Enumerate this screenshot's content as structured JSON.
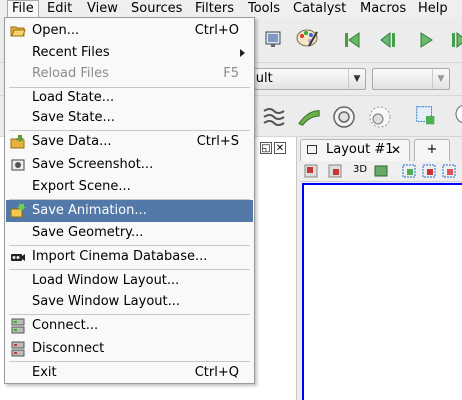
{
  "menubar": {
    "items": [
      {
        "label": "File"
      },
      {
        "label": "Edit"
      },
      {
        "label": "View"
      },
      {
        "label": "Sources"
      },
      {
        "label": "Filters"
      },
      {
        "label": "Tools"
      },
      {
        "label": "Catalyst"
      },
      {
        "label": "Macros"
      },
      {
        "label": "Help"
      }
    ]
  },
  "toolbar": {
    "representation_value": "esult",
    "second_combo_value": ""
  },
  "file_menu": {
    "items": [
      {
        "label": "Open...",
        "shortcut": "Ctrl+O",
        "icon": "folder-open-icon"
      },
      {
        "label": "Recent Files",
        "shortcut": "",
        "icon": ""
      },
      {
        "label": "Reload Files",
        "shortcut": "F5",
        "icon": ""
      },
      {
        "label": "Load State...",
        "shortcut": "",
        "icon": ""
      },
      {
        "label": "Save State...",
        "shortcut": "",
        "icon": ""
      },
      {
        "label": "Save Data...",
        "shortcut": "Ctrl+S",
        "icon": "save-data-icon"
      },
      {
        "label": "Save Screenshot...",
        "shortcut": "",
        "icon": "screenshot-icon"
      },
      {
        "label": "Export Scene...",
        "shortcut": "",
        "icon": ""
      },
      {
        "label": "Save Animation...",
        "shortcut": "",
        "icon": "save-animation-icon"
      },
      {
        "label": "Save Geometry...",
        "shortcut": "",
        "icon": ""
      },
      {
        "label": "Import Cinema Database...",
        "shortcut": "",
        "icon": "cinema-icon"
      },
      {
        "label": "Load Window Layout...",
        "shortcut": "",
        "icon": ""
      },
      {
        "label": "Save Window Layout...",
        "shortcut": "",
        "icon": ""
      },
      {
        "label": "Connect...",
        "shortcut": "",
        "icon": "connect-icon"
      },
      {
        "label": "Disconnect",
        "shortcut": "",
        "icon": "disconnect-icon"
      },
      {
        "label": "Exit",
        "shortcut": "Ctrl+Q",
        "icon": ""
      }
    ]
  },
  "layout_tabs": {
    "tab1": "Layout #1",
    "close": "✕",
    "add": "+"
  },
  "view_toolbar": {
    "label_3d": "3D"
  },
  "colors": {
    "highlight": "#5279a7",
    "render_border": "#0000ff"
  }
}
